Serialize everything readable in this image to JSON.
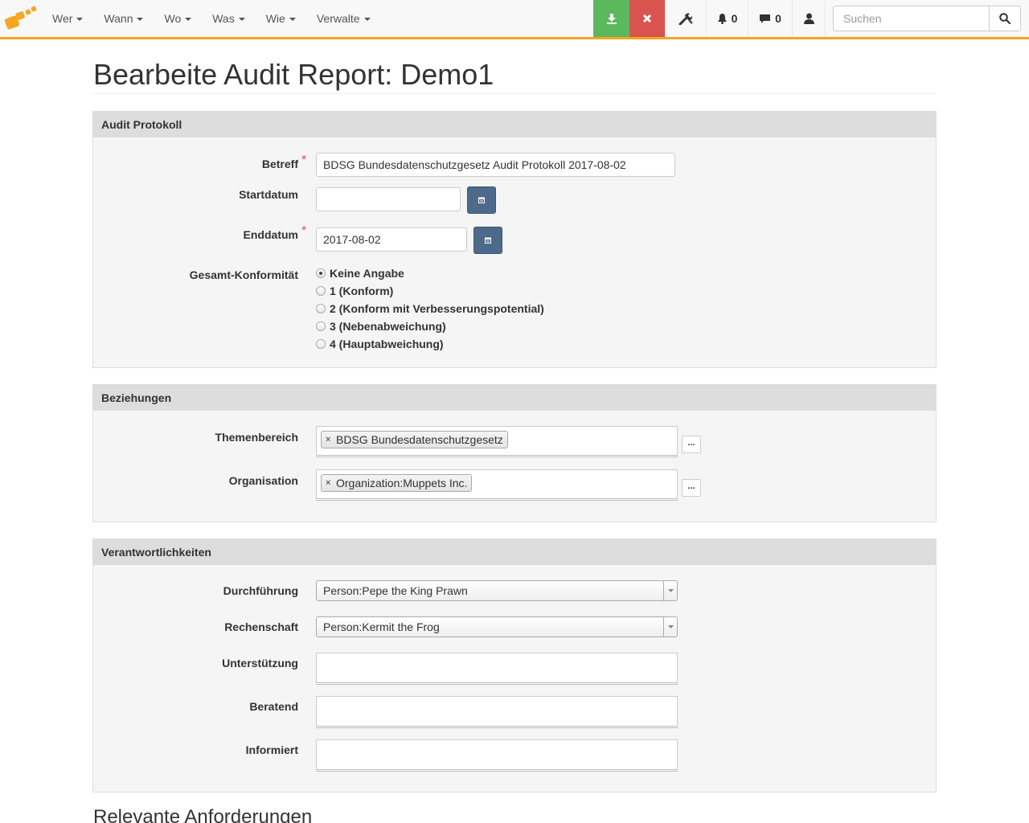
{
  "nav": {
    "menu": [
      {
        "label": "Wer"
      },
      {
        "label": "Wann"
      },
      {
        "label": "Wo"
      },
      {
        "label": "Was"
      },
      {
        "label": "Wie"
      },
      {
        "label": "Verwalte"
      }
    ],
    "notifications_count": "0",
    "messages_count": "0",
    "search_placeholder": "Suchen",
    "colors": {
      "accent": "#f5a623",
      "save": "#5cb85c",
      "cancel": "#d9534f"
    }
  },
  "page": {
    "title": "Bearbeite Audit Report: Demo1",
    "next_section_title": "Relevante Anforderungen"
  },
  "audit_protokoll": {
    "heading": "Audit Protokoll",
    "betreff_label": "Betreff",
    "betreff_value": "BDSG Bundesdatenschutzgesetz Audit Protokoll 2017-08-02",
    "startdatum_label": "Startdatum",
    "startdatum_value": "",
    "enddatum_label": "Enddatum",
    "enddatum_value": "2017-08-02",
    "konformitaet_label": "Gesamt-Konformität",
    "konformitaet_options": [
      {
        "label": "Keine Angabe",
        "checked": true
      },
      {
        "label": "1 (Konform)",
        "checked": false
      },
      {
        "label": "2 (Konform mit Verbesserungspotential)",
        "checked": false
      },
      {
        "label": "3 (Nebenabweichung)",
        "checked": false
      },
      {
        "label": "4 (Hauptabweichung)",
        "checked": false
      }
    ]
  },
  "beziehungen": {
    "heading": "Beziehungen",
    "themenbereich_label": "Themenbereich",
    "themenbereich_tag": "BDSG Bundesdatenschutzgesetz",
    "organisation_label": "Organisation",
    "organisation_tag": "Organization:Muppets Inc.",
    "more_button": "..."
  },
  "verantwortlichkeiten": {
    "heading": "Verantwortlichkeiten",
    "durchfuehrung_label": "Durchführung",
    "durchfuehrung_value": "Person:Pepe the King Prawn",
    "rechenschaft_label": "Rechenschaft",
    "rechenschaft_value": "Person:Kermit the Frog",
    "unterstuetzung_label": "Unterstützung",
    "beratend_label": "Beratend",
    "informiert_label": "Informiert"
  }
}
